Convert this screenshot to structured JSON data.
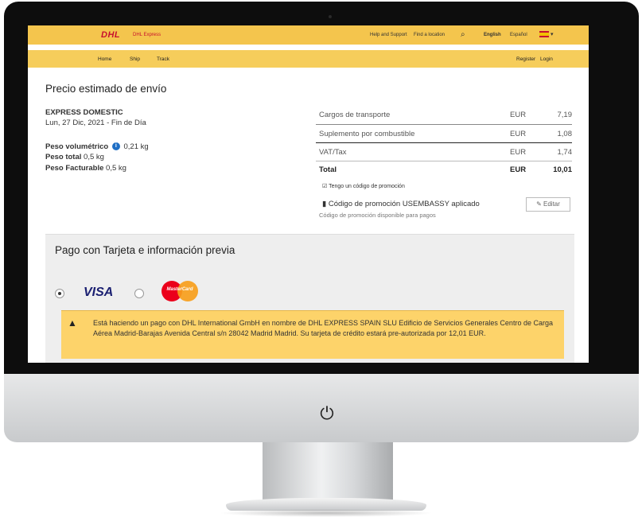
{
  "header": {
    "logo": "DHL",
    "brand": "DHL Express",
    "help": "Help and Support",
    "find_location": "Find a location",
    "lang_english": "English",
    "lang_espanol": "Español",
    "register": "Register",
    "login": "Login"
  },
  "nav": {
    "items": [
      "Home",
      "Ship",
      "Track"
    ]
  },
  "estimate": {
    "title": "Precio estimado de envío",
    "service": "EXPRESS DOMESTIC",
    "date": "Lun, 27 Dic, 2021 - Fin de Día",
    "vol_weight_label": "Peso volumétrico",
    "vol_weight_value": "0,21 kg",
    "total_weight_label": "Peso total",
    "total_weight_value": "0,5 kg",
    "billable_label": "Peso Facturable",
    "billable_value": "0,5 kg"
  },
  "costs": {
    "rows": [
      {
        "label": "Cargos de transporte",
        "currency": "EUR",
        "value": "7,19"
      },
      {
        "label": "Suplemento por combustible",
        "currency": "EUR",
        "value": "1,08"
      },
      {
        "label": "VAT/Tax",
        "currency": "EUR",
        "value": "1,74"
      }
    ],
    "total_label": "Total",
    "total_currency": "EUR",
    "total_value": "10,01"
  },
  "promo": {
    "have_code": "Tengo un código de promoción",
    "applied": "Código de promoción USEMBASSY aplicado",
    "edit": "Editar",
    "note": "Código de promoción disponible para pagos"
  },
  "payment": {
    "title": "Pago con Tarjeta e información previa",
    "visa": "VISA",
    "mastercard": "MasterCard",
    "warning": "Está haciendo un pago con DHL International GmbH en nombre de DHL EXPRESS SPAIN SLU Edificio de Servicios Generales Centro de Carga Aérea Madrid-Barajas Avenida Central s/n 28042 Madrid Madrid. Su tarjeta de crédito estará pre-autorizada por 12,01 EUR."
  },
  "colors": {
    "dhl_yellow": "#f4c54d",
    "dhl_red": "#c8102e",
    "warning_bg": "#fdd36a"
  }
}
